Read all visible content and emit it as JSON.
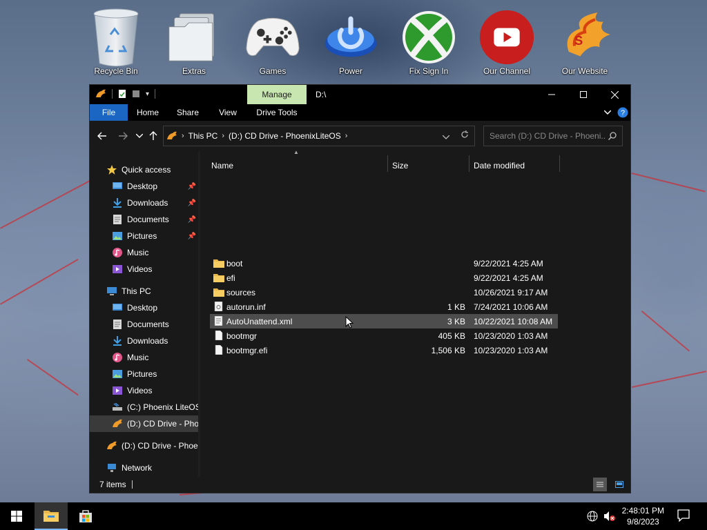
{
  "desktop": {
    "icons": [
      {
        "label": "Recycle Bin",
        "icon": "recycle-bin-icon"
      },
      {
        "label": "Extras",
        "icon": "folder-stack-icon"
      },
      {
        "label": "Games",
        "icon": "gamepad-icon"
      },
      {
        "label": "Power",
        "icon": "power-icon"
      },
      {
        "label": "Fix Sign In",
        "icon": "xbox-icon"
      },
      {
        "label": "Our Channel",
        "icon": "youtube-icon"
      },
      {
        "label": "Our Website",
        "icon": "phoenix-logo-icon"
      }
    ]
  },
  "window": {
    "contextual_tab": "Manage",
    "title": "D:\\",
    "ribbon_tabs": [
      "File",
      "Home",
      "Share",
      "View",
      "Drive Tools"
    ],
    "address": {
      "crumbs": [
        "This PC",
        "(D:) CD Drive - PhoenixLiteOS"
      ]
    },
    "search_placeholder": "Search (D:) CD Drive - Phoeni...",
    "columns": {
      "name": "Name",
      "size": "Size",
      "date": "Date modified"
    },
    "files": [
      {
        "name": "boot",
        "size": "",
        "date": "9/22/2021 4:25 AM",
        "type": "folder"
      },
      {
        "name": "efi",
        "size": "",
        "date": "9/22/2021 4:25 AM",
        "type": "folder"
      },
      {
        "name": "sources",
        "size": "",
        "date": "10/26/2021 9:17 AM",
        "type": "folder"
      },
      {
        "name": "autorun.inf",
        "size": "1 KB",
        "date": "7/24/2021 10:06 AM",
        "type": "settings-file"
      },
      {
        "name": "AutoUnattend.xml",
        "size": "3 KB",
        "date": "10/22/2021 10:08 AM",
        "type": "xml-file"
      },
      {
        "name": "bootmgr",
        "size": "405 KB",
        "date": "10/23/2020 1:03 AM",
        "type": "file"
      },
      {
        "name": "bootmgr.efi",
        "size": "1,506 KB",
        "date": "10/23/2020 1:03 AM",
        "type": "file"
      }
    ],
    "status": "7 items"
  },
  "nav": {
    "quick_access": "Quick access",
    "quick_items": [
      "Desktop",
      "Downloads",
      "Documents",
      "Pictures",
      "Music",
      "Videos"
    ],
    "this_pc": "This PC",
    "pc_items": [
      "Desktop",
      "Documents",
      "Downloads",
      "Music",
      "Pictures",
      "Videos",
      "(C:) Phoenix LiteOS",
      "(D:) CD Drive - Phoe"
    ],
    "drive": "(D:) CD Drive - Phoer",
    "network": "Network"
  },
  "taskbar": {
    "time": "2:48:01 PM",
    "date": "9/8/2023"
  },
  "colors": {
    "accent": "#1a66c2",
    "manage_tab": "#c8e6b0",
    "folder": "#e8b84a"
  }
}
